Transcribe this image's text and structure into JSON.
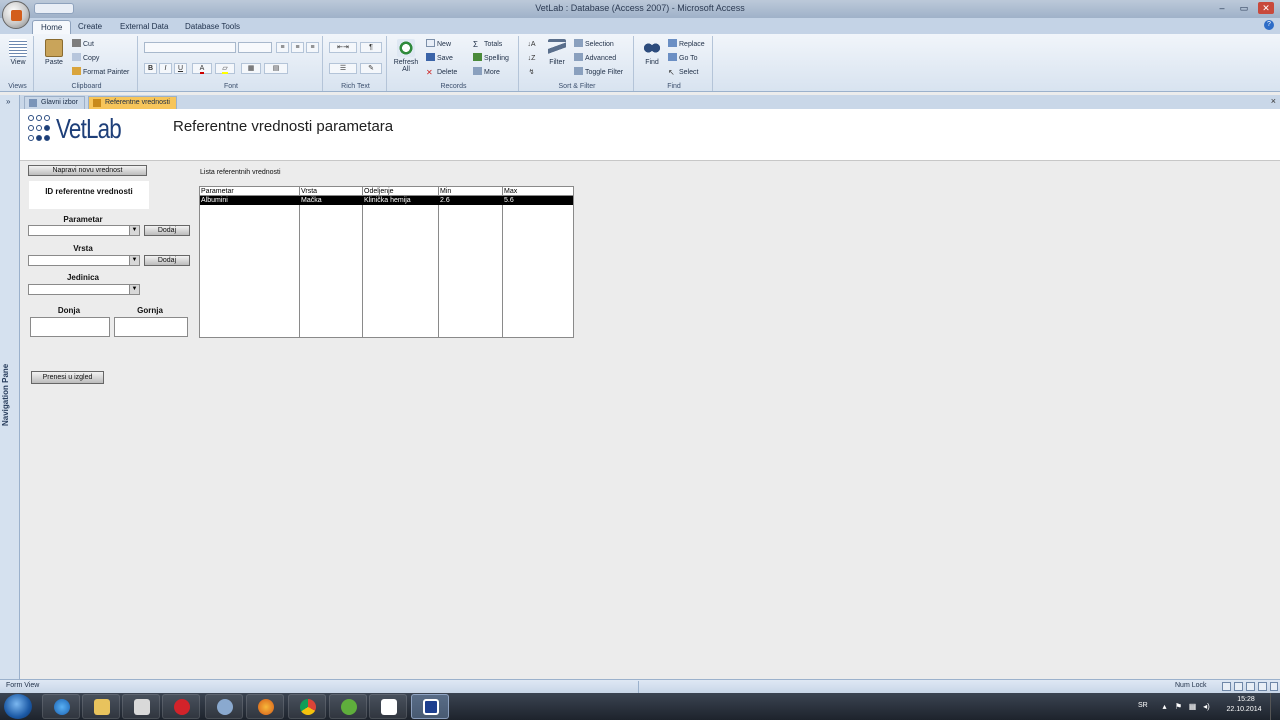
{
  "window": {
    "title": "VetLab : Database (Access 2007) - Microsoft Access",
    "minimize": "–",
    "maximize": "▭",
    "close": "✕"
  },
  "ribbon": {
    "tabs": [
      "Home",
      "Create",
      "External Data",
      "Database Tools"
    ],
    "active_tab": "Home",
    "help": "?",
    "groups": {
      "views": {
        "label": "Views",
        "view": "View"
      },
      "clipboard": {
        "label": "Clipboard",
        "paste": "Paste",
        "cut": "Cut",
        "copy": "Copy",
        "format_painter": "Format Painter"
      },
      "font": {
        "label": "Font",
        "bold": "B",
        "italic": "I",
        "underline": "U"
      },
      "rich_text": {
        "label": "Rich Text"
      },
      "records": {
        "label": "Records",
        "refresh": "Refresh All",
        "new": "New",
        "save": "Save",
        "delete": "Delete",
        "totals": "Totals",
        "spelling": "Spelling",
        "more": "More"
      },
      "sort_filter": {
        "label": "Sort & Filter",
        "filter": "Filter",
        "selection": "Selection",
        "advanced": "Advanced",
        "toggle_filter": "Toggle Filter"
      },
      "find": {
        "label": "Find",
        "find": "Find",
        "replace": "Replace",
        "goto": "Go To",
        "select": "Select"
      }
    }
  },
  "doc_tabs": [
    {
      "label": "Glavni izbor",
      "active": false
    },
    {
      "label": "Referentne vrednosti",
      "active": true
    }
  ],
  "doc_close": "×",
  "nav_pane": {
    "toggle": "»",
    "label": "Navigation Pane"
  },
  "form": {
    "logo_text": "VetLab",
    "title": "Referentne vrednosti parametara",
    "new_value_button": "Napravi novu vrednost",
    "id_label": "ID referentne vrednosti",
    "parametar_label": "Parametar",
    "vrsta_label": "Vrsta",
    "jedinica_label": "Jedinica",
    "donja_label": "Donja",
    "gornja_label": "Gornja",
    "add_label": "Dodaj",
    "transfer_button": "Prenesi u izgled",
    "dropdown_glyph": "▼",
    "list": {
      "label": "Lista referentnih vrednosti",
      "columns": [
        "Parametar",
        "Vrsta",
        "Odeljenje",
        "Min",
        "Max"
      ],
      "rows": [
        [
          "Albumini",
          "Mačka",
          "Klinička hemija",
          "2.6",
          "5.6"
        ]
      ]
    }
  },
  "statusbar": {
    "left": "Form View",
    "numlock": "Num Lock"
  },
  "taskbar": {
    "apps": [
      "internet-explorer",
      "file-explorer",
      "media-player",
      "e-app",
      "app-5",
      "firefox",
      "chrome",
      "utorrent",
      "notepad",
      "access"
    ],
    "lang": "SR",
    "time": "15:28",
    "date": "22.10.2014"
  }
}
